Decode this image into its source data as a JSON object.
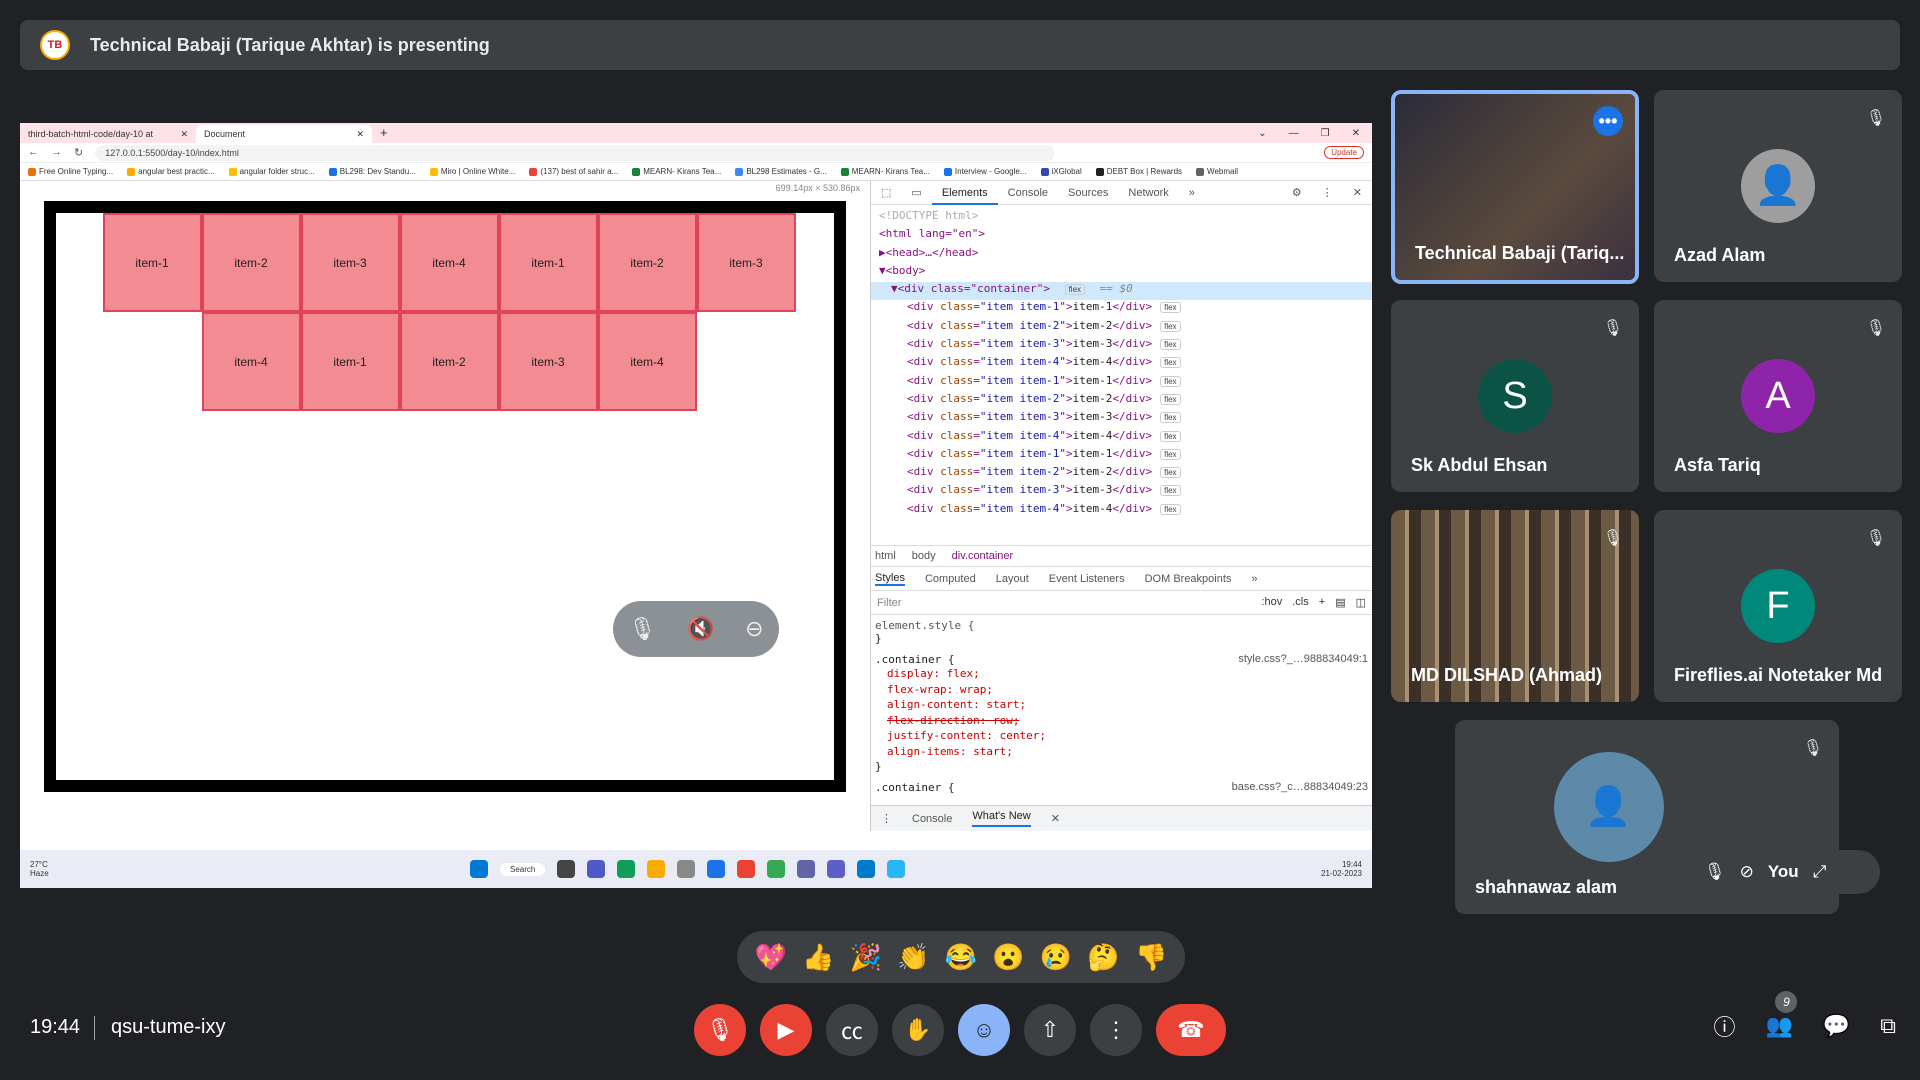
{
  "banner": {
    "logo_text": "TB",
    "text": "Technical Babaji (Tarique Akhtar) is presenting"
  },
  "browser": {
    "tabs": [
      {
        "label": "third-batch-html-code/day-10 at"
      },
      {
        "label": "Document"
      }
    ],
    "new_tab": "+",
    "url": "127.0.0.1:5500/day-10/index.html",
    "update_label": "Update",
    "bookmarks": [
      "Free Online Typing...",
      "angular best practic...",
      "angular folder struc...",
      "BL298: Dev Standu...",
      "Miro | Online White...",
      "(137) best of sahir a...",
      "MEARN- Kirans Tea...",
      "BL298 Estimates - G...",
      "MEARN- Kirans Tea...",
      "Interview - Google...",
      "iXGlobal",
      "DEBT Box | Rewards",
      "Webmail"
    ]
  },
  "page": {
    "dims": "699.14px × 530.86px",
    "items": [
      "item-1",
      "item-2",
      "item-3",
      "item-4",
      "item-1",
      "item-2",
      "item-3",
      "item-4",
      "item-1",
      "item-2",
      "item-3",
      "item-4"
    ]
  },
  "devtools": {
    "tabs": [
      "Elements",
      "Console",
      "Sources",
      "Network",
      "»"
    ],
    "dom": {
      "doctype": "<!DOCTYPE html>",
      "html_open": "<html lang=\"en\">",
      "head": "▶<head>…</head>",
      "body": "▼<body>",
      "container": "▼<div class=\"container\">",
      "container_suffix": "== $0",
      "children": [
        {
          "cls": "item item-1",
          "text": "item-1"
        },
        {
          "cls": "item item-2",
          "text": "item-2"
        },
        {
          "cls": "item item-3",
          "text": "item-3"
        },
        {
          "cls": "item item-4",
          "text": "item-4"
        },
        {
          "cls": "item item-1",
          "text": "item-1"
        },
        {
          "cls": "item item-2",
          "text": "item-2"
        },
        {
          "cls": "item item-3",
          "text": "item-3"
        },
        {
          "cls": "item item-4",
          "text": "item-4"
        },
        {
          "cls": "item item-1",
          "text": "item-1"
        },
        {
          "cls": "item item-2",
          "text": "item-2"
        },
        {
          "cls": "item item-3",
          "text": "item-3"
        },
        {
          "cls": "item item-4",
          "text": "item-4"
        }
      ],
      "badge": "flex"
    },
    "breadcrumbs": [
      "html",
      "body",
      "div.container"
    ],
    "style_tabs": [
      "Styles",
      "Computed",
      "Layout",
      "Event Listeners",
      "DOM Breakpoints",
      "»"
    ],
    "filter_placeholder": "Filter",
    "hov": ":hov",
    "cls": ".cls",
    "element_style": "element.style {",
    "rule1": {
      "selector": ".container {",
      "source": "style.css?_…988834049:1",
      "props": [
        "display: flex;",
        "flex-wrap: wrap;",
        "align-content: start;",
        "flex-direction: row;",
        "justify-content: center;",
        "align-items: start;"
      ]
    },
    "rule2": {
      "selector": ".container {",
      "source": "base.css?_c…88834049:23"
    },
    "drawer_tabs": [
      "Console",
      "What's New"
    ]
  },
  "taskbar": {
    "temp": "27°C",
    "weather": "Haze",
    "search": "Search",
    "time": "19:44",
    "date": "21-02-2023"
  },
  "participants": [
    {
      "name": "Technical Babaji (Tariq...",
      "more": "•••"
    },
    {
      "name": "Azad Alam"
    },
    {
      "name": "Sk Abdul Ehsan",
      "initial": "S",
      "color": "#0b5345"
    },
    {
      "name": "Asfa Tariq",
      "initial": "A",
      "color": "#8e24aa"
    },
    {
      "name": "MD DILSHAD (Ahmad)"
    },
    {
      "name": "Fireflies.ai Notetaker Md",
      "initial": "F",
      "color": "#00897b"
    },
    {
      "name": "shahnawaz alam",
      "you_label": "You"
    }
  ],
  "reactions": [
    "💖",
    "👍",
    "🎉",
    "👏",
    "😂",
    "😮",
    "😢",
    "🤔",
    "👎"
  ],
  "meeting": {
    "time": "19:44",
    "code": "qsu-tume-ixy",
    "participant_count": "9"
  }
}
